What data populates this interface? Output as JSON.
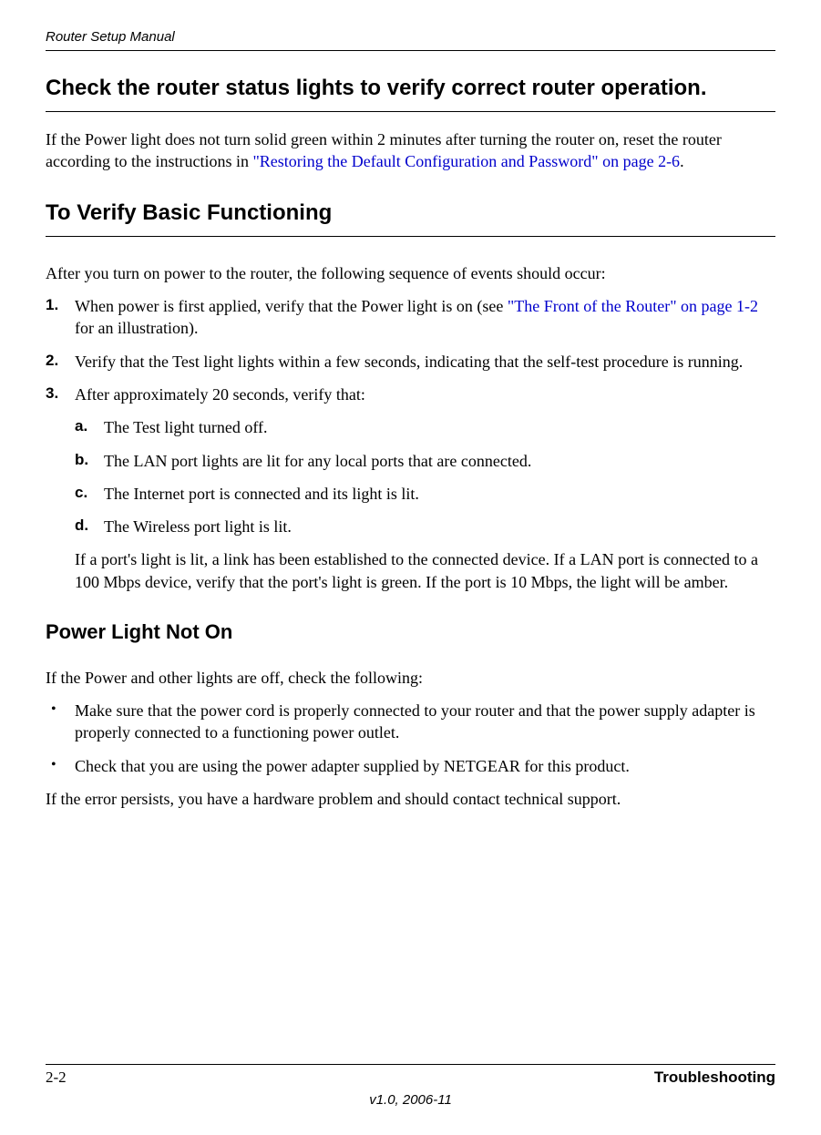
{
  "header": "Router Setup Manual",
  "h1": "Check the router status lights to verify correct router operation.",
  "intro": {
    "part1": "If the Power light does not turn solid green within 2 minutes after turning the router on, reset the router according to the instructions in ",
    "link1": "\"Restoring the Default Configuration and Password\" on page 2-6",
    "part2": "."
  },
  "h2": "To Verify Basic Functioning",
  "afterPower": "After you turn on power to the router, the following sequence of events should occur:",
  "steps": {
    "s1": {
      "marker": "1.",
      "part1": "When power is first applied, verify that the Power light is on (see ",
      "link": "\"The Front of the Router\" on page 1-2",
      "part2": " for an illustration)."
    },
    "s2": {
      "marker": "2.",
      "text": "Verify that the Test light lights within a few seconds, indicating that the self-test procedure is running."
    },
    "s3": {
      "marker": "3.",
      "text": "After approximately 20 seconds, verify that:",
      "a": {
        "marker": "a.",
        "text": "The Test light turned off."
      },
      "b": {
        "marker": "b.",
        "text": "The LAN port lights are lit for any local ports that are connected."
      },
      "c": {
        "marker": "c.",
        "text": "The Internet port is connected and its light is lit."
      },
      "d": {
        "marker": "d.",
        "text": "The Wireless port light is lit."
      },
      "after": "If a port's light is lit, a link has been established to the connected device. If a LAN port is connected to a 100 Mbps device, verify that the port's light is green. If the port is 10 Mbps, the light will be amber."
    }
  },
  "h3": "Power Light Not On",
  "powerIntro": "If the Power and other lights are off, check the following:",
  "bullets": {
    "b1": "Make sure that the power cord is properly connected to your router and that the power supply adapter is properly connected to a functioning power outlet.",
    "b2": "Check that you are using the power adapter supplied by NETGEAR for this product."
  },
  "powerOutro": "If the error persists, you have a hardware problem and should contact technical support.",
  "footer": {
    "page": "2-2",
    "section": "Troubleshooting",
    "version": "v1.0, 2006-11"
  }
}
